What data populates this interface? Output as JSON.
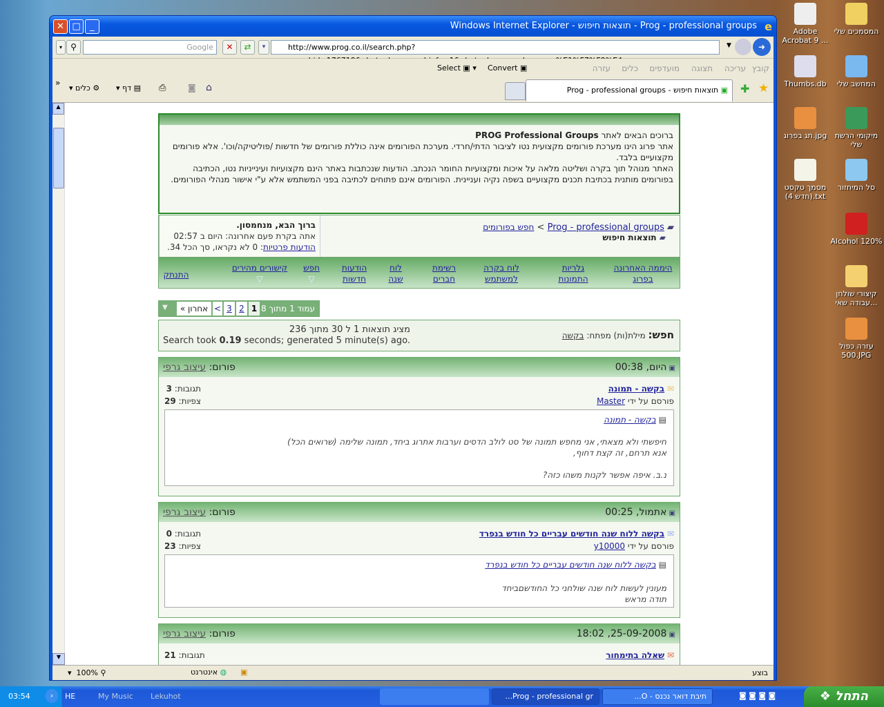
{
  "desktop": {
    "icons": [
      "המסמכים שלי",
      "Adobe Acrobat 9 ...",
      "המחשב שלי",
      "Thumbs.db",
      "מיקומי הרשת שלי",
      "תג בפרוג.jpg",
      "סל המיחזור",
      "מסמך טקסט (חדש 4).txt",
      "Alcohol 120%",
      "קיצורי שולחן עבודה שאי...",
      "עזרה כפול 500.JPG"
    ]
  },
  "window": {
    "title": "Windows Internet Explorer - תוצאות חיפוש - Prog - professional groups"
  },
  "address": {
    "url": "http://www.prog.co.il/search.php?searchid=176719&photoplog_searchinfo=1&photoplog_searchquery=%E1%F7%F9%E4",
    "search_placeholder": "Google"
  },
  "menu": {
    "items": [
      "קובץ",
      "עריכה",
      "תצוגה",
      "מועדפים",
      "כלים",
      "עזרה"
    ],
    "select": "Select",
    "convert": "Convert"
  },
  "tab": {
    "label": "תוצאות חיפוש - Prog - professional groups"
  },
  "toolbar": {
    "page": "דף",
    "tools": "כלים"
  },
  "welcome": {
    "greeting": "ברוכים הבאים לאתר ",
    "brand": "PROG Professional Groups",
    "p1": "אתר פרוג הינו מערכת פורומים מקצועית נטו לציבור הדתי/חרדי.  מערכת הפורומים אינה כוללת פורומים של חדשות /פוליטיקה/וכו'. אלא פורומים מקצועיים בלבד.",
    "p2": "האתר מנוהל תוך בקרה ושליטה מלאה על איכות ומקצועיות החומר הנכתב.  הודעות שנכתבות באתר הינם מקצועיות ועינייניות נטו, הכתיבה בפורומים מותנית בכתיבת תכנים מקצועיים בשפה נקיה ועניינית.  הפורומים אינם פתוחים לכתיבה בפני המשתמש אלא ע\"י אישור מנהלי הפורומים."
  },
  "breadcrumb": {
    "home": "Prog - professional groups",
    "sep": ">",
    "search": "חפש בפורומים",
    "current": "תוצאות חיפוש"
  },
  "user": {
    "hello": "ברוך הבא, מנחמסון.",
    "last_visit": "אתה בקרת פעם אחרונה:  היום ב 02:57",
    "pm_label": "הודעות פרטיות",
    "pm_text": ": 0 לא נקראו, סך הכל 34."
  },
  "nav": [
    {
      "l1": "היממה האחרונה",
      "l2": "בפרוג"
    },
    {
      "l1": "גלריות",
      "l2": "התמונות"
    },
    {
      "l1": "לוח בקרה",
      "l2": "למשתמש"
    },
    {
      "l1": "רשימת",
      "l2": "חברים"
    },
    {
      "l1": "לוח",
      "l2": "שנה"
    },
    {
      "l1": "הודעות",
      "l2": "חדשות"
    },
    {
      "l1": "חפש",
      "l2": "▽"
    },
    {
      "l1": "קישורים מהירים",
      "l2": "▽"
    },
    {
      "l1": "התנתק",
      "l2": ""
    }
  ],
  "pagination": {
    "label": "עמוד 1 מתוך 8",
    "pages": [
      "1",
      "2",
      "3"
    ],
    "next": ">",
    "last": "אחרון »"
  },
  "search_info": {
    "label": "חפש:",
    "keywords_label": "מילת(ות) מפתח:",
    "keyword": "בקשה",
    "showing": "מציג תוצאות 1 ל 30 מתוך 236",
    "took_pre": "Search took ",
    "took_val": "0.19",
    "took_post": " seconds; generated 5 minute(s) ago."
  },
  "posts": [
    {
      "date": "היום, 00:38",
      "forum_label": "פורום:",
      "forum": "עיצוב גרפי",
      "title": "בקשה - תמונה",
      "by": "פורסם על ידי",
      "author": "Master",
      "replies_label": "תגובות:",
      "replies": "3",
      "views_label": "צפיות:",
      "views": "29",
      "excerpt_title": "בקשה - תמונה",
      "lines": [
        "חיפשתי ולא מצאתי, אני מחפש תמונה של סט לולב הדסים וערבות אתרוג ביחד, תמונה שלימה (שרואים הכל)",
        "אנא תרחם, זה קצת דחוף,",
        "",
        "נ.ב. איפה אפשר לקנות משהו כזה?"
      ]
    },
    {
      "date": "אתמול, 00:25",
      "forum_label": "פורום:",
      "forum": "עיצוב גרפי",
      "title": "בקשה ללוח שנה חודשים עבריים כל חודש בנפרד",
      "by": "פורסם על ידי",
      "author": "y10000",
      "replies_label": "תגובות:",
      "replies": "0",
      "views_label": "צפיות:",
      "views": "23",
      "excerpt_title": "בקשה ללוח שנה חודשים עבריים כל חודש בנפרד",
      "lines": [
        "מעונין לעשות לוח שנה שולחני כל החודשםביחד",
        "תודה מראש"
      ]
    },
    {
      "date": "25-09-2008, 18:02",
      "forum_label": "פורום:",
      "forum": "עיצוב גרפי",
      "title": "שאלה בתימחור",
      "replies_label": "תגובות:",
      "replies": "21"
    }
  ],
  "status": {
    "done": "בוצע",
    "zone": "אינטרנט",
    "zoom": "100%"
  },
  "taskbar": {
    "start": "התחל",
    "tasks": [
      "תיבת דואר נכנס - O...",
      "Prog - professional gr..."
    ],
    "toolbars": [
      "Lekuhot",
      "My Music"
    ],
    "lang": "HE",
    "clock": "03:54"
  }
}
